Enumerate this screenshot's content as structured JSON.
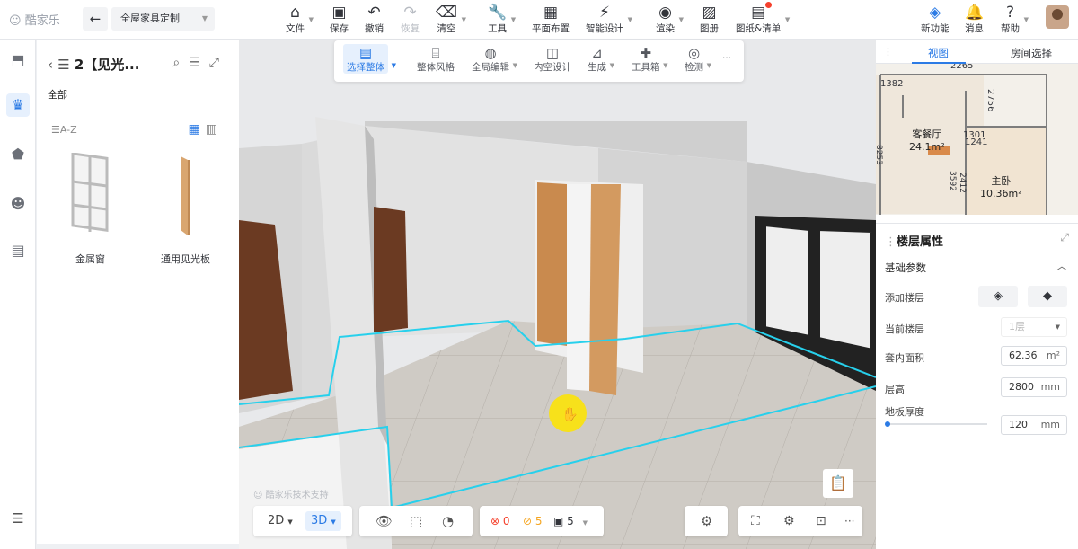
{
  "app": {
    "logo": "酷家乐",
    "project_name": "全屋家具定制"
  },
  "toolbar": {
    "file": "文件",
    "save": "保存",
    "undo": "撤销",
    "redo": "恢复",
    "clear": "清空",
    "tools": "工具",
    "floor_plan": "平面布置",
    "smart_design": "智能设计",
    "render": "渲染",
    "album": "图册",
    "drawings": "图纸&清单",
    "new_feature": "新功能",
    "messages": "消息",
    "help": "帮助"
  },
  "left_panel": {
    "title": "2【见光...",
    "all_label": "全部",
    "sort_label": "A-Z",
    "items": [
      {
        "label": "金属窗"
      },
      {
        "label": "通用见光板"
      }
    ]
  },
  "float_toolbar": {
    "select_whole": "选择整体",
    "style": "整体风格",
    "global_paste": "全局编辑",
    "inner_design": "内空设计",
    "generate": "生成",
    "toolbox": "工具箱",
    "detect": "检测",
    "more": "···"
  },
  "bottom_toolbar": {
    "mode_2d": "2D",
    "mode_3d": "3D",
    "errors": "0",
    "warnings": "5",
    "hints": "5",
    "more": "···"
  },
  "watermark": "酷家乐技术支持",
  "right_panel": {
    "tabs": [
      "视图",
      "房间选择"
    ],
    "minimap": {
      "dims": [
        "2265",
        "1382",
        "2756",
        "1301",
        "1241",
        "3592",
        "2412",
        "8253"
      ],
      "rooms": [
        {
          "name": "客餐厅",
          "area": "24.1m²"
        },
        {
          "name": "主卧",
          "area": "10.36m²"
        }
      ]
    },
    "props": {
      "title": "楼层属性",
      "section": "基础参数",
      "add_floor": "添加楼层",
      "current_floor": "当前楼层",
      "current_floor_value": "1层",
      "inner_area": "套内面积",
      "inner_area_value": "62.36",
      "inner_area_unit": "m²",
      "floor_height": "层高",
      "floor_height_value": "2800",
      "floor_height_unit": "mm",
      "slab_thickness": "地板厚度",
      "slab_thickness_value": "120",
      "slab_thickness_unit": "mm"
    }
  },
  "colors": {
    "accent": "#2c7be5",
    "selection": "#1fd3ef",
    "cursor": "#f7e11b"
  }
}
